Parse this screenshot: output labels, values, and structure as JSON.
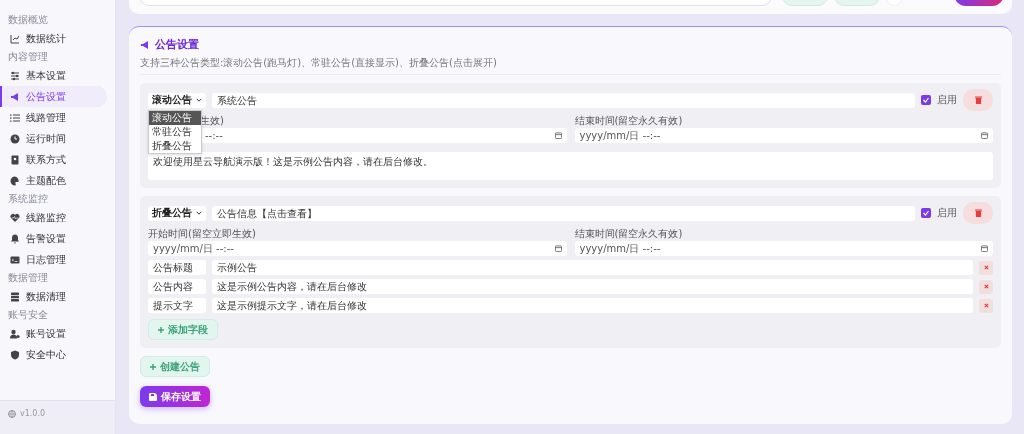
{
  "sidebar": {
    "sections": [
      {
        "title": "数据概览",
        "items": [
          {
            "label": "数据统计",
            "selected": false
          }
        ]
      },
      {
        "title": "内容管理",
        "items": [
          {
            "label": "基本设置",
            "selected": false
          },
          {
            "label": "公告设置",
            "selected": true
          },
          {
            "label": "线路管理",
            "selected": false
          },
          {
            "label": "运行时间",
            "selected": false
          },
          {
            "label": "联系方式",
            "selected": false
          },
          {
            "label": "主题配色",
            "selected": false
          }
        ]
      },
      {
        "title": "系统监控",
        "items": [
          {
            "label": "线路监控",
            "selected": false
          },
          {
            "label": "告警设置",
            "selected": false
          },
          {
            "label": "日志管理",
            "selected": false
          }
        ]
      },
      {
        "title": "数据管理",
        "items": [
          {
            "label": "数据清理",
            "selected": false
          }
        ]
      },
      {
        "title": "账号安全",
        "items": [
          {
            "label": "账号设置",
            "selected": false
          },
          {
            "label": "安全中心",
            "selected": false
          }
        ]
      }
    ],
    "version": "v1.0.0"
  },
  "settings": {
    "title": "公告设置",
    "subtitle": "支持三种公告类型:滚动公告(跑马灯)、常驻公告(直接显示)、折叠公告(点击展开)",
    "announcements": [
      {
        "kind": "scroll",
        "type_label": "滚动公告",
        "title": "系统公告",
        "enabled": true,
        "enabled_label": "启用",
        "start_label": "生效)",
        "start_value": "--:--",
        "end_label": "结束时间(留空永久有效)",
        "end_value": "yyyy/mm/日 --:--",
        "content": "欢迎使用星云导航演示版！这是示例公告内容，请在后台修改。",
        "dropdown": {
          "options": [
            {
              "label": "滚动公告",
              "selected": true
            },
            {
              "label": "常驻公告",
              "selected": false
            },
            {
              "label": "折叠公告",
              "selected": false
            }
          ]
        }
      },
      {
        "kind": "fold",
        "type_label": "折叠公告",
        "title": "公告信息【点击查看】",
        "enabled": true,
        "enabled_label": "启用",
        "start_label": "开始时间(留空立即生效)",
        "start_value": "yyyy/mm/日 --:--",
        "end_label": "结束时间(留空永久有效)",
        "end_value": "yyyy/mm/日 --:--",
        "fields": [
          {
            "key": "公告标题",
            "value": "示例公告"
          },
          {
            "key": "公告内容",
            "value": "这是示例公告内容，请在后台修改"
          },
          {
            "key": "提示文字",
            "value": "这是示例提示文字，请在后台修改"
          }
        ],
        "add_field_label": "添加字段"
      }
    ],
    "create_label": "创建公告",
    "save_label": "保存设置"
  }
}
